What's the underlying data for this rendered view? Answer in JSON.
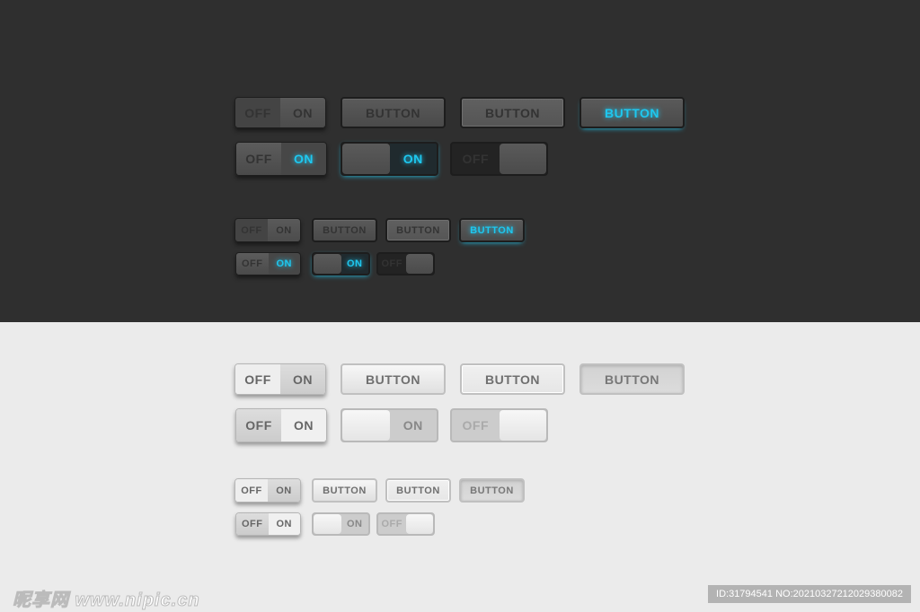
{
  "accent_color": "#1ec8f0",
  "dark_background": "#2f2f2f",
  "light_background": "#ebebeb",
  "themes": [
    {
      "theme": "dark",
      "large": {
        "rocker_top": {
          "off": "OFF",
          "on": "ON"
        },
        "buttons": [
          "BUTTON",
          "BUTTON",
          "BUTTON"
        ],
        "rocker_bottom": {
          "off": "OFF",
          "on": "ON",
          "state": "on"
        },
        "slide_on": {
          "label": "ON",
          "state": "on"
        },
        "slide_off": {
          "label": "OFF",
          "state": "off"
        }
      },
      "small": {
        "rocker_top": {
          "off": "OFF",
          "on": "ON"
        },
        "buttons": [
          "BUTTON",
          "BUTTON",
          "BUTTON"
        ],
        "rocker_bottom": {
          "off": "OFF",
          "on": "ON",
          "state": "on"
        },
        "slide_on": {
          "label": "ON",
          "state": "on"
        },
        "slide_off": {
          "label": "OFF",
          "state": "off"
        }
      }
    },
    {
      "theme": "light",
      "large": {
        "rocker_top": {
          "off": "OFF",
          "on": "ON"
        },
        "buttons": [
          "BUTTON",
          "BUTTON",
          "BUTTON"
        ],
        "rocker_bottom": {
          "off": "OFF",
          "on": "ON",
          "state": "off"
        },
        "slide_on": {
          "label": "ON",
          "state": "on"
        },
        "slide_off": {
          "label": "OFF",
          "state": "off"
        }
      },
      "small": {
        "rocker_top": {
          "off": "OFF",
          "on": "ON"
        },
        "buttons": [
          "BUTTON",
          "BUTTON",
          "BUTTON"
        ],
        "rocker_bottom": {
          "off": "OFF",
          "on": "ON",
          "state": "off"
        },
        "slide_on": {
          "label": "ON",
          "state": "on"
        },
        "slide_off": {
          "label": "OFF",
          "state": "off"
        }
      }
    }
  ],
  "watermark": {
    "logo": "昵享网 www.nipic.cn",
    "id": "ID:31794541 NO:20210327212029380082"
  }
}
